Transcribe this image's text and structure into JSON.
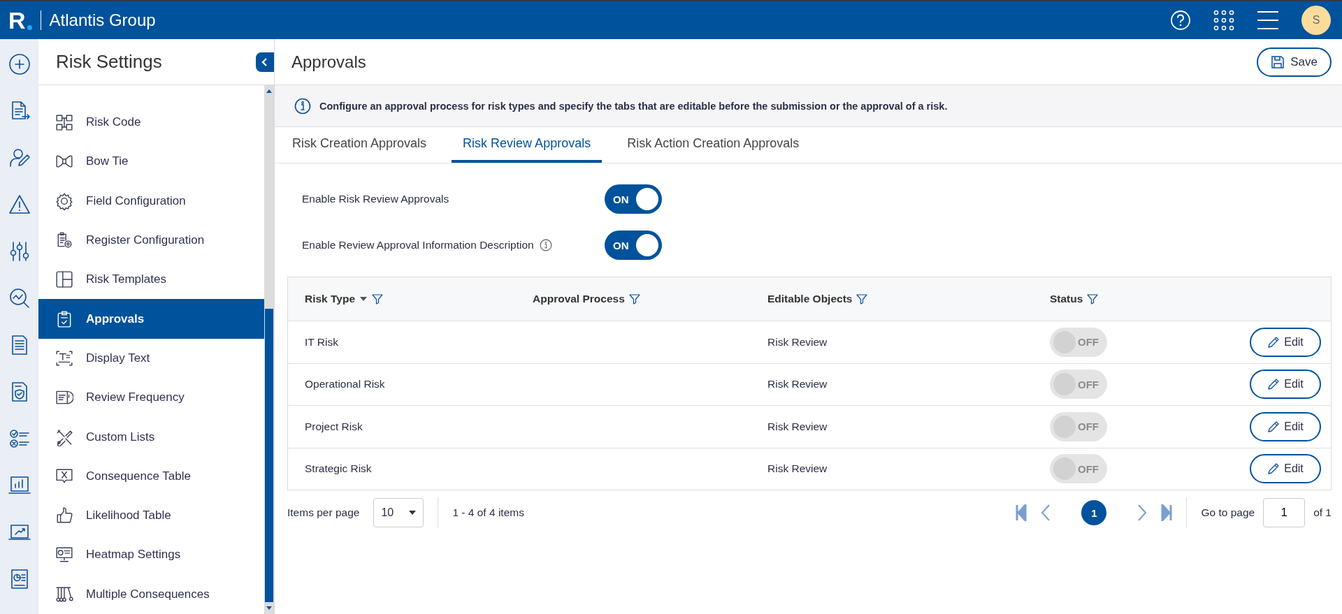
{
  "header": {
    "logo": "R",
    "org": "Atlantis Group",
    "avatar": "S"
  },
  "sidebar": {
    "title": "Risk Settings",
    "items": [
      {
        "label": "Risk Code",
        "selected": false
      },
      {
        "label": "Bow Tie",
        "selected": false
      },
      {
        "label": "Field Configuration",
        "selected": false
      },
      {
        "label": "Register Configuration",
        "selected": false
      },
      {
        "label": "Risk Templates",
        "selected": false
      },
      {
        "label": "Approvals",
        "selected": true
      },
      {
        "label": "Display Text",
        "selected": false
      },
      {
        "label": "Review Frequency",
        "selected": false
      },
      {
        "label": "Custom Lists",
        "selected": false
      },
      {
        "label": "Consequence Table",
        "selected": false
      },
      {
        "label": "Likelihood Table",
        "selected": false
      },
      {
        "label": "Heatmap Settings",
        "selected": false
      },
      {
        "label": "Multiple Consequences",
        "selected": false
      }
    ]
  },
  "page": {
    "title": "Approvals",
    "save": "Save",
    "info": "Configure an approval process for risk types and specify the tabs that are editable before the submission or the approval of a risk.",
    "tabs": [
      {
        "label": "Risk Creation Approvals",
        "selected": false
      },
      {
        "label": "Risk Review Approvals",
        "selected": true
      },
      {
        "label": "Risk Action Creation Approvals",
        "selected": false
      }
    ],
    "settings": [
      {
        "label": "Enable Risk Review Approvals",
        "info": false,
        "on": true,
        "state_text": "ON"
      },
      {
        "label": "Enable Review Approval Information Description",
        "info": true,
        "on": true,
        "state_text": "ON"
      }
    ]
  },
  "table": {
    "columns": [
      {
        "label": "Risk Type",
        "sorted": true
      },
      {
        "label": "Approval Process",
        "sorted": false
      },
      {
        "label": "Editable Objects",
        "sorted": false
      },
      {
        "label": "Status",
        "sorted": false
      }
    ],
    "rows": [
      {
        "risk_type": "IT Risk",
        "editable_objects": "Risk Review",
        "status": {
          "on": false,
          "disabled": true,
          "text": "OFF"
        },
        "action": "Edit"
      },
      {
        "risk_type": "Operational Risk",
        "editable_objects": "Risk Review",
        "status": {
          "on": false,
          "disabled": true,
          "text": "OFF"
        },
        "action": "Edit"
      },
      {
        "risk_type": "Project Risk",
        "editable_objects": "Risk Review",
        "status": {
          "on": false,
          "disabled": true,
          "text": "OFF"
        },
        "action": "Edit"
      },
      {
        "risk_type": "Strategic Risk",
        "editable_objects": "Risk Review",
        "status": {
          "on": false,
          "disabled": true,
          "text": "OFF"
        },
        "action": "Edit"
      }
    ]
  },
  "pager": {
    "items_label": "Items per page",
    "page_size": "10",
    "range": "1 - 4 of 4 items",
    "pages": [
      {
        "label": "1",
        "selected": true
      }
    ],
    "goto_label": "Go to page",
    "goto_value": "1",
    "of": "of 1"
  }
}
